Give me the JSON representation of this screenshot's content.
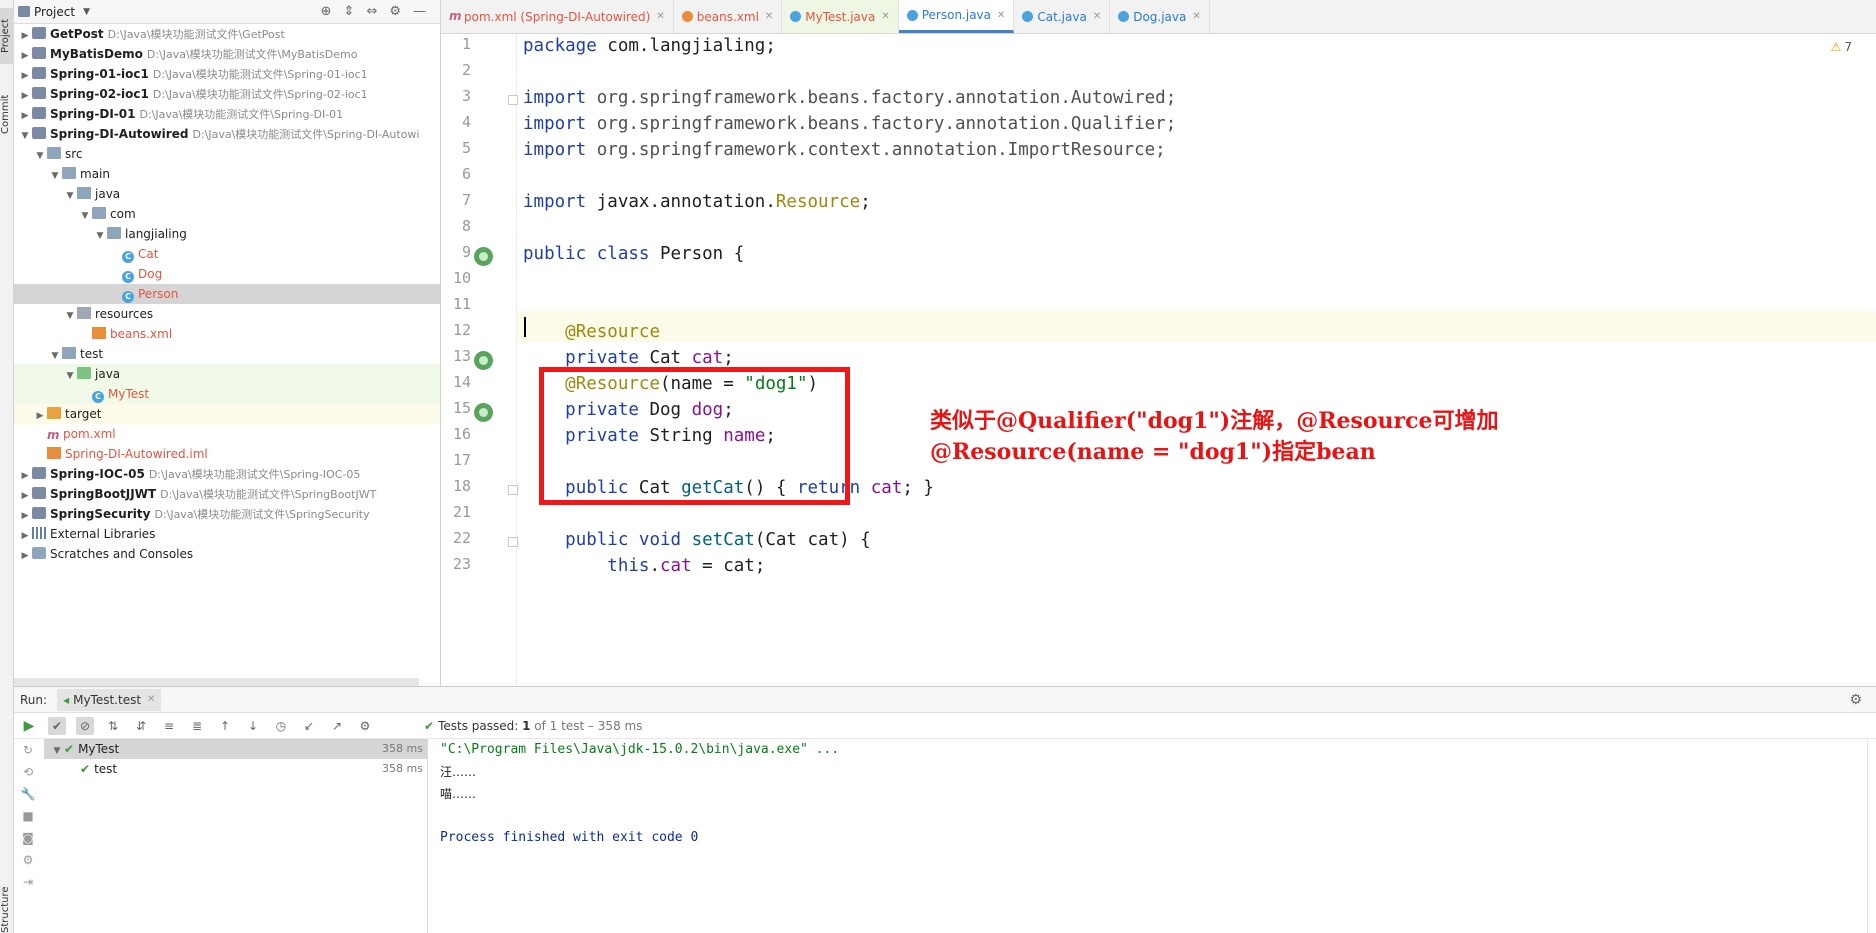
{
  "sidebar": {
    "project_tab": "Project",
    "commit_tab": "Commit",
    "structure_tab": "Structure"
  },
  "project": {
    "title": "Project",
    "items": [
      {
        "label": "GetPost",
        "path": "D:\\Java\\模块功能测试文件\\GetPost",
        "depth": 0,
        "expanded": false,
        "icon": "module-icon"
      },
      {
        "label": "MyBatisDemo",
        "path": "D:\\Java\\模块功能测试文件\\MyBatisDemo",
        "depth": 0,
        "expanded": false,
        "icon": "module-icon"
      },
      {
        "label": "Spring-01-ioc1",
        "path": "D:\\Java\\模块功能测试文件\\Spring-01-ioc1",
        "depth": 0,
        "expanded": false,
        "icon": "module-icon"
      },
      {
        "label": "Spring-02-ioc1",
        "path": "D:\\Java\\模块功能测试文件\\Spring-02-ioc1",
        "depth": 0,
        "expanded": false,
        "icon": "module-icon"
      },
      {
        "label": "Spring-DI-01",
        "path": "D:\\Java\\模块功能测试文件\\Spring-DI-01",
        "depth": 0,
        "expanded": false,
        "icon": "module-icon"
      },
      {
        "label": "Spring-DI-Autowired",
        "path": "D:\\Java\\模块功能测试文件\\Spring-DI-Autowi",
        "depth": 0,
        "expanded": true,
        "icon": "module-icon"
      },
      {
        "label": "src",
        "depth": 1,
        "expanded": true,
        "icon": "folder-icon"
      },
      {
        "label": "main",
        "depth": 2,
        "expanded": true,
        "icon": "folder-icon"
      },
      {
        "label": "java",
        "depth": 3,
        "expanded": true,
        "icon": "source-folder-icon"
      },
      {
        "label": "com",
        "depth": 4,
        "expanded": true,
        "icon": "package-icon"
      },
      {
        "label": "langjialing",
        "depth": 5,
        "expanded": true,
        "icon": "package-icon"
      },
      {
        "label": "Cat",
        "depth": 6,
        "icon": "class-icon",
        "red": true
      },
      {
        "label": "Dog",
        "depth": 6,
        "icon": "class-icon",
        "red": true
      },
      {
        "label": "Person",
        "depth": 6,
        "icon": "class-icon",
        "red": true,
        "selected": true
      },
      {
        "label": "resources",
        "depth": 3,
        "expanded": true,
        "icon": "resources-folder-icon"
      },
      {
        "label": "beans.xml",
        "depth": 4,
        "icon": "xml-file-icon",
        "red": true
      },
      {
        "label": "test",
        "depth": 2,
        "expanded": true,
        "icon": "folder-icon"
      },
      {
        "label": "java",
        "depth": 3,
        "expanded": true,
        "icon": "test-folder-icon",
        "test_hl": true
      },
      {
        "label": "MyTest",
        "depth": 4,
        "icon": "test-class-icon",
        "red": true,
        "test_hl": true
      },
      {
        "label": "target",
        "depth": 1,
        "expanded": false,
        "icon": "target-folder-icon",
        "target_hl": true
      },
      {
        "label": "pom.xml",
        "depth": 1,
        "icon": "maven-icon",
        "red": true
      },
      {
        "label": "Spring-DI-Autowired.iml",
        "depth": 1,
        "icon": "iml-file-icon",
        "red": true
      },
      {
        "label": "Spring-IOC-05",
        "path": "D:\\Java\\模块功能测试文件\\Spring-IOC-05",
        "depth": 0,
        "expanded": false,
        "icon": "module-icon"
      },
      {
        "label": "SpringBootJJWT",
        "path": "D:\\Java\\模块功能测试文件\\SpringBootJWT",
        "depth": 0,
        "expanded": false,
        "icon": "module-icon"
      },
      {
        "label": "SpringSecurity",
        "path": "D:\\Java\\模块功能测试文件\\SpringSecurity",
        "depth": 0,
        "expanded": false,
        "icon": "module-icon"
      },
      {
        "label": "External Libraries",
        "depth": 0,
        "expanded": false,
        "icon": "libraries-icon",
        "plain": true
      },
      {
        "label": "Scratches and Consoles",
        "depth": 0,
        "expanded": false,
        "icon": "scratches-icon",
        "plain": true
      }
    ]
  },
  "tabs": [
    {
      "label": "pom.xml (Spring-DI-Autowired)",
      "icon": "maven-icon"
    },
    {
      "label": "beans.xml",
      "icon": "xml-file-icon"
    },
    {
      "label": "MyTest.java",
      "icon": "test-class-icon"
    },
    {
      "label": "Person.java",
      "icon": "class-icon",
      "active": true
    },
    {
      "label": "Cat.java",
      "icon": "class-icon"
    },
    {
      "label": "Dog.java",
      "icon": "class-icon"
    }
  ],
  "editor": {
    "warnings": "7",
    "line_numbers": [
      "1",
      "2",
      "3",
      "4",
      "5",
      "6",
      "7",
      "8",
      "9",
      "10",
      "11",
      "12",
      "13",
      "14",
      "15",
      "16",
      "17",
      "18",
      "21",
      "22",
      "23"
    ],
    "code": [
      [
        {
          "t": "package ",
          "c": "kw"
        },
        {
          "t": "com.langjialing;"
        }
      ],
      [],
      [
        {
          "t": "import ",
          "c": "kw"
        },
        {
          "t": "org.springframework.beans.factory.annotation.Autowired;",
          "c": "imp"
        }
      ],
      [
        {
          "t": "import ",
          "c": "kw"
        },
        {
          "t": "org.springframework.beans.factory.annotation.Qualifier;",
          "c": "imp"
        }
      ],
      [
        {
          "t": "import ",
          "c": "kw"
        },
        {
          "t": "org.springframework.context.annotation.ImportResource;",
          "c": "imp"
        }
      ],
      [],
      [
        {
          "t": "import ",
          "c": "kw"
        },
        {
          "t": "javax.annotation."
        },
        {
          "t": "Resource",
          "c": "ann"
        },
        {
          "t": ";"
        }
      ],
      [],
      [
        {
          "t": "public class ",
          "c": "kw"
        },
        {
          "t": "Person {"
        }
      ],
      [],
      [],
      [
        {
          "t": "    "
        },
        {
          "t": "@Resource",
          "c": "ann"
        }
      ],
      [
        {
          "t": "    "
        },
        {
          "t": "private ",
          "c": "kw"
        },
        {
          "t": "Cat "
        },
        {
          "t": "cat",
          "c": "field"
        },
        {
          "t": ";"
        }
      ],
      [
        {
          "t": "    "
        },
        {
          "t": "@Resource",
          "c": "ann"
        },
        {
          "t": "(name = "
        },
        {
          "t": "\"dog1\"",
          "c": "str"
        },
        {
          "t": ")"
        }
      ],
      [
        {
          "t": "    "
        },
        {
          "t": "private ",
          "c": "kw"
        },
        {
          "t": "Dog "
        },
        {
          "t": "dog",
          "c": "field"
        },
        {
          "t": ";"
        }
      ],
      [
        {
          "t": "    "
        },
        {
          "t": "private ",
          "c": "kw"
        },
        {
          "t": "String "
        },
        {
          "t": "name",
          "c": "field"
        },
        {
          "t": ";"
        }
      ],
      [],
      [
        {
          "t": "    "
        },
        {
          "t": "public ",
          "c": "kw"
        },
        {
          "t": "Cat "
        },
        {
          "t": "getCat",
          "c": "method"
        },
        {
          "t": "() { "
        },
        {
          "t": "return ",
          "c": "kw"
        },
        {
          "t": "cat",
          "c": "field"
        },
        {
          "t": "; }"
        }
      ],
      [],
      [
        {
          "t": "    "
        },
        {
          "t": "public void ",
          "c": "kw"
        },
        {
          "t": "setCat",
          "c": "method"
        },
        {
          "t": "(Cat cat) {"
        }
      ],
      [
        {
          "t": "        "
        },
        {
          "t": "this",
          "c": "kw"
        },
        {
          "t": "."
        },
        {
          "t": "cat",
          "c": "field"
        },
        {
          "t": " = cat;"
        }
      ]
    ],
    "annotation_note": "类似于@Qualifier(\"dog1\")注解，@Resource可增加\n@Resource(name = \"dog1\")指定bean"
  },
  "run": {
    "label": "Run:",
    "tab": "MyTest.test",
    "status_prefix": "Tests passed:",
    "status_count": "1",
    "status_rest": "of 1 test – 358 ms",
    "tree": [
      {
        "label": "MyTest",
        "time": "358 ms",
        "depth": 0,
        "selected": true
      },
      {
        "label": "test",
        "time": "358 ms",
        "depth": 1
      }
    ],
    "console": [
      {
        "text": "\"C:\\Program Files\\Java\\jdk-15.0.2\\bin\\java.exe\" ...",
        "c": "c-cmd"
      },
      {
        "text": "汪……",
        "c": "c-out"
      },
      {
        "text": "喵……",
        "c": "c-out"
      },
      {
        "text": "",
        "c": "c-out"
      },
      {
        "text": "Process finished with exit code 0",
        "c": "c-blue"
      }
    ]
  }
}
